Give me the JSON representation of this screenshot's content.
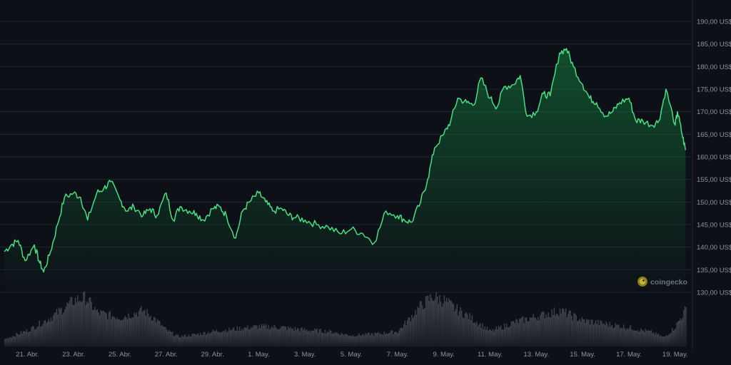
{
  "chart_data": {
    "type": "area",
    "title": "",
    "xlabel": "",
    "ylabel": "",
    "ylim": [
      130,
      190
    ],
    "y_tick_values": [
      130,
      135,
      140,
      145,
      150,
      155,
      160,
      165,
      170,
      175,
      180,
      185,
      190
    ],
    "y_tick_labels": [
      "130,00 US$",
      "135,00 US$",
      "140,00 US$",
      "145,00 US$",
      "150,00 US$",
      "155,00 US$",
      "160,00 US$",
      "165,00 US$",
      "170,00 US$",
      "175,00 US$",
      "180,00 US$",
      "185,00 US$",
      "190,00 US$"
    ],
    "x_tick_labels": [
      "21. Abr.",
      "23. Abr.",
      "25. Abr.",
      "27. Abr.",
      "29. Abr.",
      "1. May.",
      "3. May.",
      "5. May.",
      "7. May.",
      "9. May.",
      "11. May.",
      "13. May.",
      "15. May.",
      "17. May.",
      "19. May."
    ],
    "x_tick_day_index": [
      1,
      3,
      5,
      7,
      9,
      11,
      13,
      15,
      17,
      19,
      21,
      23,
      25,
      27,
      29
    ],
    "x_range_days": [
      0,
      29.5
    ],
    "price_series": {
      "name": "Price",
      "color": "#4ade80",
      "x_days": [
        0,
        0.3,
        0.6,
        0.9,
        1.3,
        1.5,
        1.7,
        2.0,
        2.3,
        2.6,
        3.0,
        3.3,
        3.6,
        4.0,
        4.3,
        4.6,
        5.0,
        5.3,
        5.6,
        6.0,
        6.3,
        6.6,
        7.0,
        7.3,
        7.6,
        8.0,
        8.3,
        8.6,
        9.0,
        9.3,
        9.6,
        10.0,
        10.3,
        10.6,
        11.0,
        11.3,
        11.6,
        12.0,
        12.3,
        12.6,
        13.0,
        13.5,
        14.0,
        14.5,
        15.0,
        15.5,
        16.0,
        16.5,
        17.0,
        17.3,
        17.6,
        18.0,
        18.3,
        18.6,
        19.0,
        19.3,
        19.6,
        20.0,
        20.3,
        20.6,
        21.0,
        21.3,
        21.6,
        22.0,
        22.3,
        22.6,
        23.0,
        23.3,
        23.6,
        24.0,
        24.3,
        24.6,
        25.0,
        25.3,
        25.6,
        26.0,
        26.3,
        26.6,
        27.0,
        27.3,
        27.6,
        28.0,
        28.3,
        28.6,
        29.0,
        29.1,
        29.3,
        29.45
      ],
      "values": [
        139,
        140.5,
        141.5,
        137,
        140.5,
        137,
        134.5,
        139,
        145,
        151,
        152,
        151,
        146,
        152,
        153,
        154.5,
        150.5,
        148,
        149,
        147,
        148.5,
        147,
        152,
        146,
        149,
        148,
        147.5,
        146,
        148.5,
        149,
        147,
        142,
        148,
        150,
        152,
        150,
        148,
        148.5,
        147,
        146.5,
        146,
        145,
        144.5,
        143,
        144,
        143,
        141,
        148,
        147,
        146,
        145.5,
        150,
        155,
        162,
        165,
        168,
        173,
        172,
        171.5,
        177.5,
        173,
        171,
        175.5,
        176,
        178,
        169,
        170,
        174,
        173.5,
        183,
        184,
        180,
        176,
        173,
        172,
        169,
        170,
        172,
        173,
        168,
        168,
        167,
        168,
        175,
        167,
        170,
        165,
        161.5
      ]
    },
    "volume_series": {
      "name": "Volume",
      "color": "#6b7280",
      "x_days": [
        0,
        1,
        2,
        3,
        3.5,
        4,
        5,
        6,
        6.5,
        7,
        7.5,
        8,
        9,
        10,
        11,
        12,
        13,
        14,
        15,
        16,
        17,
        18,
        18.5,
        19,
        19.5,
        20,
        21,
        22,
        23,
        24,
        25,
        26,
        27,
        28,
        28.5,
        29,
        29.45
      ],
      "values": [
        0.15,
        0.32,
        0.58,
        0.92,
        0.98,
        0.68,
        0.58,
        0.72,
        0.55,
        0.32,
        0.2,
        0.22,
        0.3,
        0.35,
        0.4,
        0.38,
        0.33,
        0.3,
        0.22,
        0.25,
        0.3,
        0.82,
        1.0,
        0.92,
        0.75,
        0.62,
        0.3,
        0.48,
        0.6,
        0.72,
        0.52,
        0.45,
        0.38,
        0.28,
        0.18,
        0.4,
        0.75
      ]
    },
    "grid": true,
    "watermark": "coingecko"
  }
}
